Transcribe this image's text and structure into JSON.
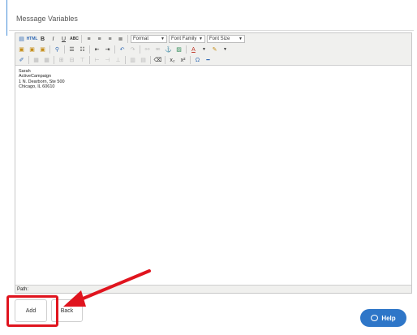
{
  "panel": {
    "title": "Message Variables"
  },
  "toolbar": {
    "format_select": "Format",
    "font_family_select": "Font Family",
    "font_size_select": "Font Size",
    "html_label": "HTML",
    "bold": "B",
    "italic": "I",
    "underline": "U",
    "strike": "ABC",
    "omega": "Ω",
    "text_color": "A"
  },
  "editor": {
    "content_lines": [
      "Sarah",
      "ActiveCampaign",
      "1 N. Dearborn, Ste 500",
      "Chicago, IL 60610"
    ],
    "path_label": "Path:"
  },
  "buttons": {
    "add": "Add",
    "back": "Back"
  },
  "help": {
    "label": "Help"
  },
  "annotation": {
    "color": "#e0141e"
  }
}
